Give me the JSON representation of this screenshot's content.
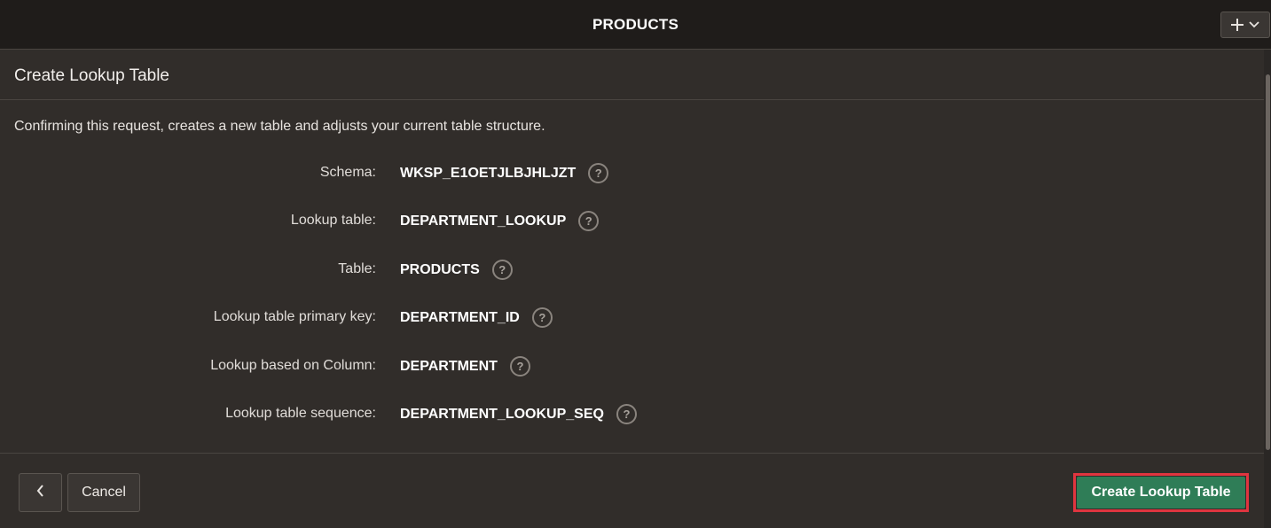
{
  "header": {
    "title": "PRODUCTS",
    "menu_button_icon": "plus-icon",
    "menu_chevron_icon": "chevron-down-icon"
  },
  "dialog": {
    "title": "Create Lookup Table",
    "intro": "Confirming this request, creates a new table and adjusts your current table structure."
  },
  "fields": [
    {
      "label": "Schema:",
      "value": "WKSP_E1OETJLBJHLJZT"
    },
    {
      "label": "Lookup table:",
      "value": "DEPARTMENT_LOOKUP"
    },
    {
      "label": "Table:",
      "value": "PRODUCTS"
    },
    {
      "label": "Lookup table primary key:",
      "value": "DEPARTMENT_ID"
    },
    {
      "label": "Lookup based on Column:",
      "value": "DEPARTMENT"
    },
    {
      "label": "Lookup table sequence:",
      "value": "DEPARTMENT_LOOKUP_SEQ"
    }
  ],
  "help_glyph": "?",
  "footer": {
    "back_icon": "chevron-left-icon",
    "cancel_label": "Cancel",
    "create_label": "Create Lookup Table"
  },
  "colors": {
    "background": "#312d2a",
    "topbar": "#1f1c1a",
    "primary_button": "#2f7d57",
    "highlight_outline": "#e0353f"
  }
}
